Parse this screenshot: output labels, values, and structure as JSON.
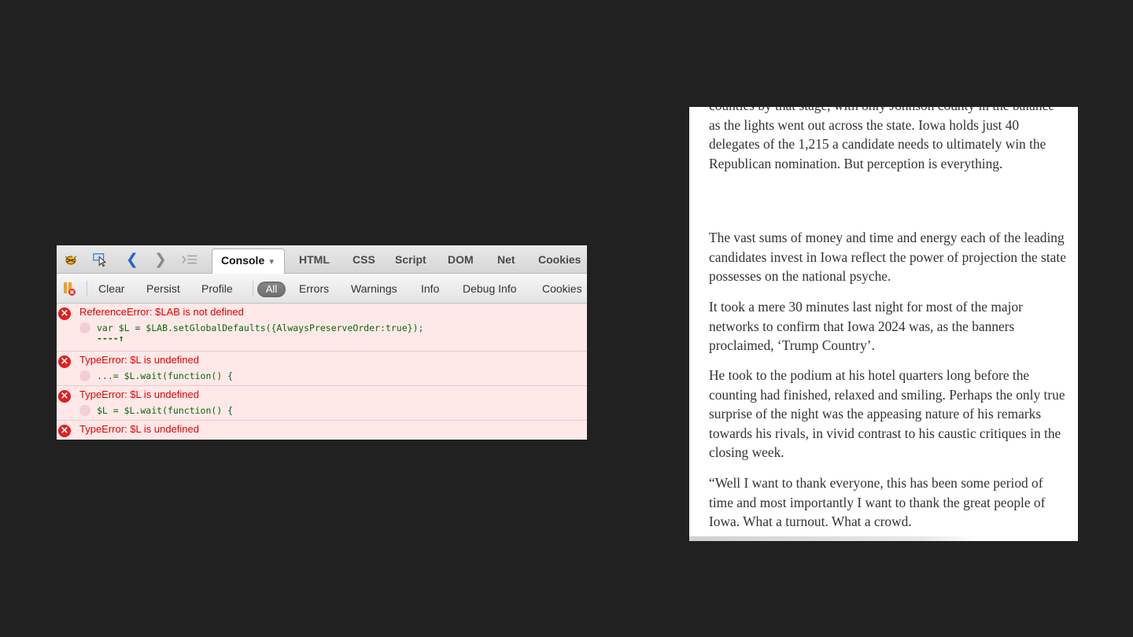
{
  "firebug": {
    "tabs": {
      "console": "Console",
      "html": "HTML",
      "css": "CSS",
      "script": "Script",
      "dom": "DOM",
      "net": "Net",
      "cookies": "Cookies"
    },
    "toolbar": {
      "clear": "Clear",
      "persist": "Persist",
      "profile": "Profile",
      "filters": {
        "all": "All",
        "errors": "Errors",
        "warnings": "Warnings",
        "info": "Info",
        "debug_info": "Debug Info",
        "cookies": "Cookies"
      }
    },
    "log": [
      {
        "message": "ReferenceError: $LAB is not defined",
        "source": "var $L = $LAB.setGlobalDefaults({AlwaysPreserveOrder:true});",
        "pointer": "----↑"
      },
      {
        "message": "TypeError: $L is undefined",
        "source": "...= $L.wait(function() {"
      },
      {
        "message": "TypeError: $L is undefined",
        "source": "$L = $L.wait(function() {"
      },
      {
        "message": "TypeError: $L is undefined"
      }
    ],
    "colors": {
      "error_text": "#e60000",
      "error_row_bg": "#ffe8e8",
      "code_text": "#0a6a0a"
    }
  },
  "article": {
    "paragraphs": [
      "counties by that stage, with only Johnson county in the balance as the lights went out across the state. Iowa holds just 40 delegates of the 1,215 a candidate needs to ultimately win the Republican nomination. But perception is everything.",
      "The vast sums of money and time and energy each of the leading candidates invest in Iowa reflect the power of projection the state possesses on the national psyche.",
      "It took a mere 30 minutes last night for most of the major networks to confirm that Iowa 2024 was, as the banners proclaimed, ‘Trump Country’.",
      "He took to the podium at his hotel quarters long before the counting had finished, relaxed and smiling. Perhaps the only true surprise of the night was the appeasing nature of his remarks towards his rivals, in vivid contrast to his caustic critiques in the closing week.",
      "“Well I want to thank everyone, this has been some period of time and most importantly I want to thank the great people of Iowa. What a turnout. What a crowd."
    ]
  }
}
